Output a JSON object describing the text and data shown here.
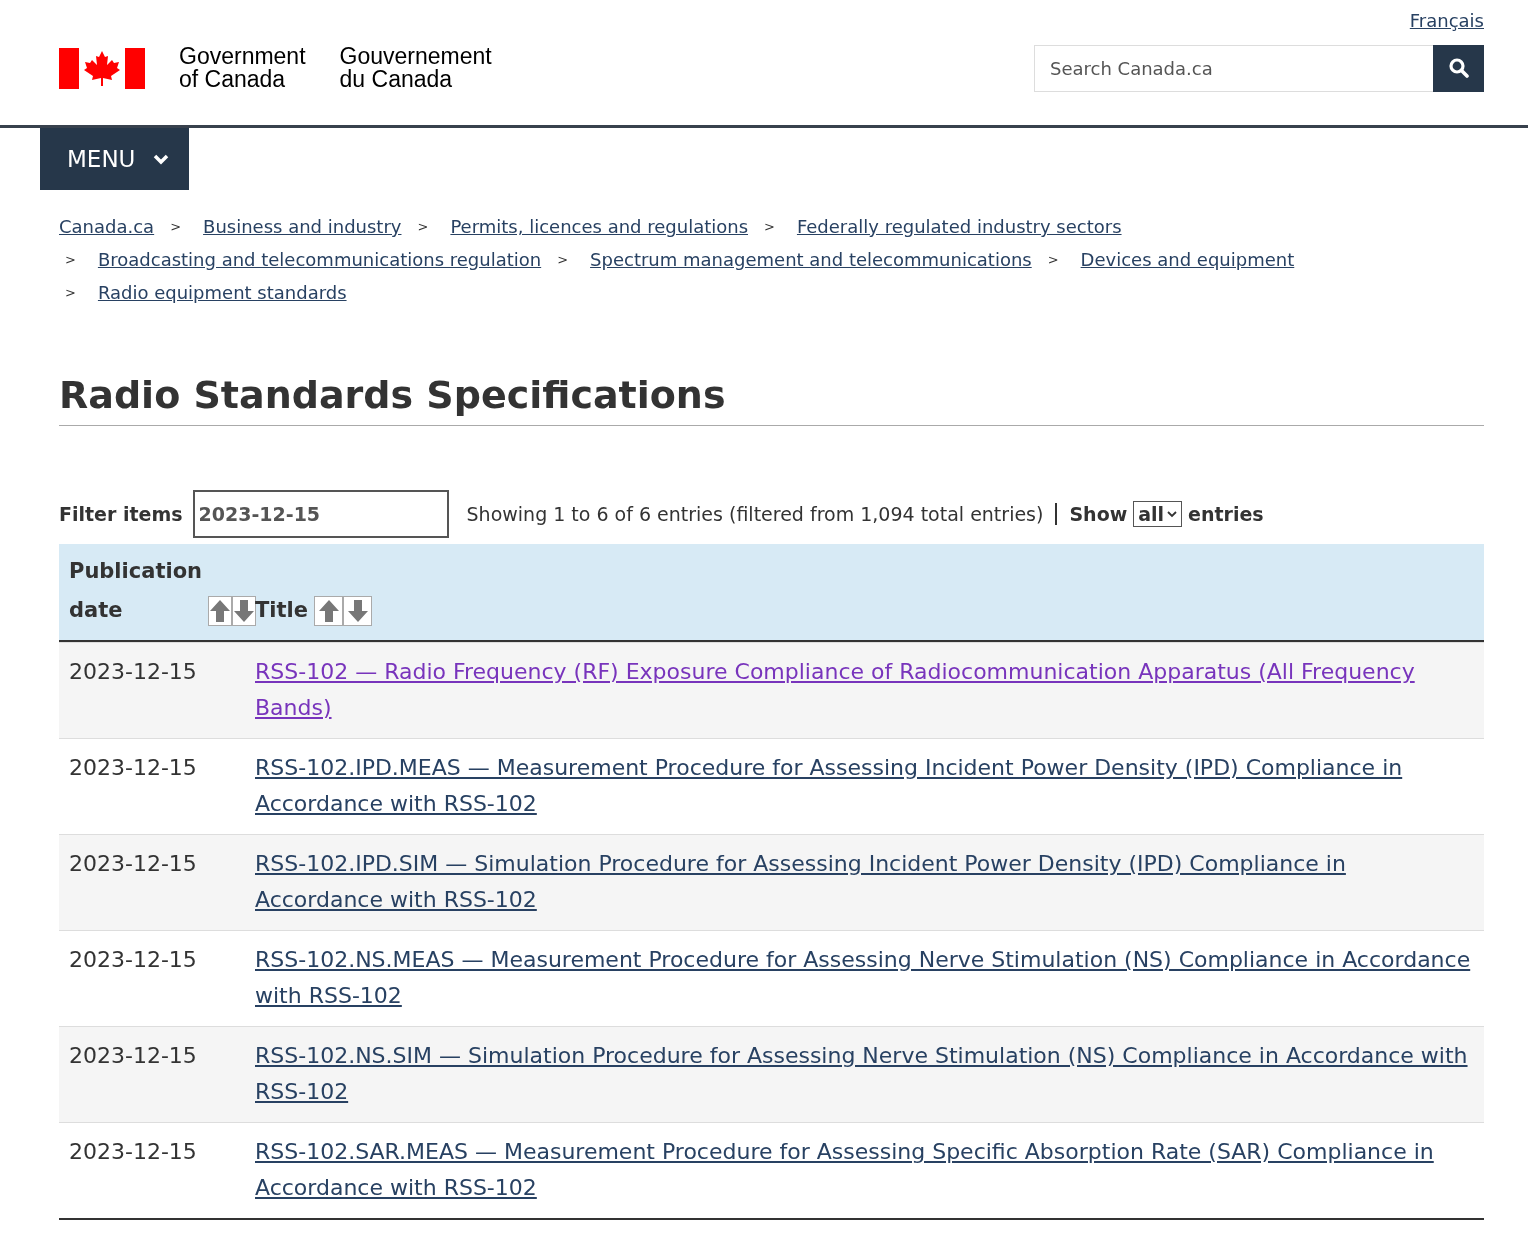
{
  "header": {
    "language_link": "Français",
    "brand_en": [
      "Government",
      "of Canada"
    ],
    "brand_fr": [
      "Gouvernement",
      "du Canada"
    ],
    "search": {
      "placeholder": "Search Canada.ca"
    }
  },
  "menu": {
    "label": "MENU",
    "expanded": false
  },
  "breadcrumbs": {
    "separator": ">",
    "items": [
      "Canada.ca",
      "Business and industry",
      "Permits, licences and regulations",
      "Federally regulated industry sectors",
      "Broadcasting and telecommunications regulation",
      "Spectrum management and telecommunications",
      "Devices and equipment",
      "Radio equipment standards"
    ]
  },
  "page_title": "Radio Standards Specifications",
  "filter": {
    "label": "Filter items",
    "value": "2023-12-15",
    "info": "Showing 1 to 6 of 6 entries (filtered from 1,094 total entries)",
    "show_label": "Show",
    "show_value": "all",
    "entries_label": "entries"
  },
  "table": {
    "columns": [
      "Publication date",
      "Title"
    ],
    "rows": [
      {
        "date": "2023-12-15",
        "title": "RSS-102 — Radio Frequency (RF) Exposure Compliance of Radiocommunication Apparatus (All Frequency Bands)",
        "visited": true
      },
      {
        "date": "2023-12-15",
        "title": "RSS-102.IPD.MEAS — Measurement Procedure for Assessing Incident Power Density (IPD) Compliance in Accordance with RSS-102",
        "visited": false
      },
      {
        "date": "2023-12-15",
        "title": "RSS-102.IPD.SIM — Simulation Procedure for Assessing Incident Power Density (IPD) Compliance in Accordance with RSS-102",
        "visited": false
      },
      {
        "date": "2023-12-15",
        "title": "RSS-102.NS.MEAS — Measurement Procedure for Assessing Nerve Stimulation (NS) Compliance in Accordance with RSS-102",
        "visited": false
      },
      {
        "date": "2023-12-15",
        "title": "RSS-102.NS.SIM — Simulation Procedure for Assessing Nerve Stimulation (NS) Compliance in Accordance with RSS-102",
        "visited": false
      },
      {
        "date": "2023-12-15",
        "title": "RSS-102.SAR.MEAS — Measurement Procedure for Assessing Specific Absorption Rate (SAR) Compliance in Accordance with RSS-102",
        "visited": false
      }
    ]
  }
}
